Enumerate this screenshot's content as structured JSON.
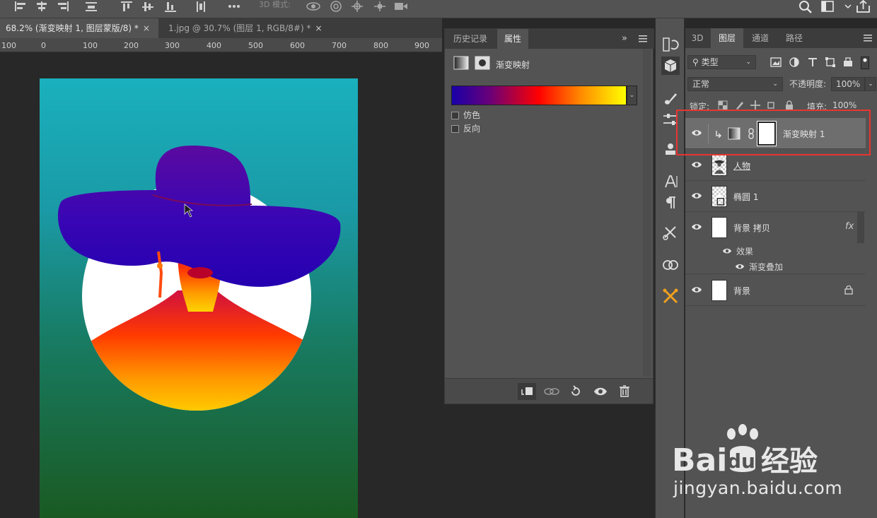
{
  "options_bar": {
    "mode_3d_label": "3D 模式:",
    "icons": [
      "align-left-icon",
      "align-center-icon",
      "align-right-icon",
      "distribute-icon",
      "align-top-icon",
      "align-middle-icon",
      "align-bottom-icon",
      "distribute-vertical-icon",
      "more-icon",
      "orbit-3d-icon",
      "roll-3d-icon",
      "pan-3d-icon",
      "slide-3d-icon",
      "zoom-3d-icon",
      "search-icon",
      "workspace-icon",
      "share-icon"
    ]
  },
  "doc_tabs": [
    {
      "label": "68.2% (渐变映射 1, 图层蒙版/8) *",
      "close": "×",
      "active": true
    },
    {
      "label": "1.jpg @ 30.7% (图层 1, RGB/8#) *",
      "close": "×",
      "active": false
    }
  ],
  "ruler": {
    "marks": [
      "100",
      "0",
      "100",
      "200",
      "300",
      "400",
      "500",
      "600",
      "700",
      "800",
      "900"
    ]
  },
  "properties_panel": {
    "tabs": [
      "历史记录",
      "属性"
    ],
    "active_tab": "属性",
    "menu_glyph": "»",
    "title": "渐变映射",
    "gradient_colors": [
      "#1800a8",
      "#6a0078",
      "#ff0000",
      "#ff8a00",
      "#ffff00"
    ],
    "dither_label": "仿色",
    "dither_checked": false,
    "reverse_label": "反向",
    "reverse_checked": false
  },
  "layers_panel": {
    "tabs": [
      "3D",
      "图层",
      "通道",
      "路径"
    ],
    "active_tab": "图层",
    "filter_label": "类型",
    "blend_mode": "正常",
    "opacity_label": "不透明度:",
    "opacity_value": "100%",
    "lock_label": "锁定:",
    "fill_label": "填充:",
    "fill_value": "100%",
    "layers": [
      {
        "name": "渐变映射 1",
        "selected": true,
        "type": "adjustment",
        "clipped": true
      },
      {
        "name": "人物",
        "selected": false,
        "type": "pixel"
      },
      {
        "name": "椭圆 1",
        "selected": false,
        "type": "shape"
      },
      {
        "name": "背景 拷贝",
        "selected": false,
        "type": "pixel",
        "fx": "fx"
      },
      {
        "name": "背景",
        "selected": false,
        "type": "background",
        "locked": true
      }
    ],
    "effects_label": "效果",
    "effect_item": "渐变叠加"
  },
  "watermark": {
    "brand": "Bai",
    "brand_cn": "经验",
    "url": "jingyan.baidu.com"
  },
  "colors": {
    "accent_highlight": "#e8352f",
    "panel_bg": "#535353",
    "canvas_bg": "#282828"
  }
}
